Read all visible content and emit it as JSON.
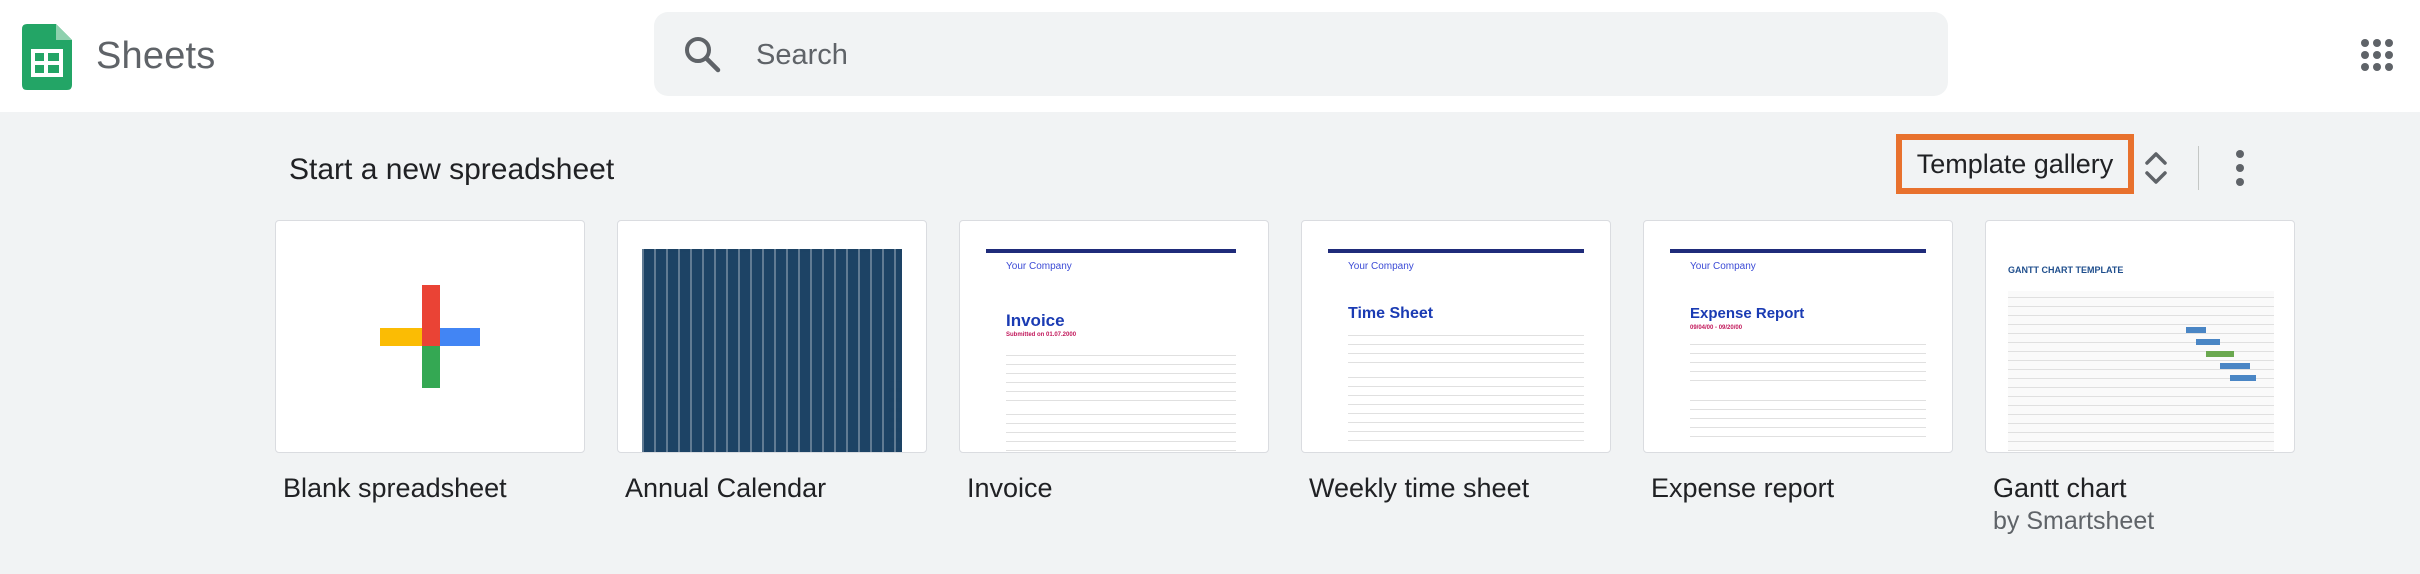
{
  "app": {
    "title": "Sheets"
  },
  "search": {
    "placeholder": "Search"
  },
  "gallery": {
    "section_title": "Start a new spreadsheet",
    "template_gallery_label": "Template gallery",
    "templates": [
      {
        "label": "Blank spreadsheet"
      },
      {
        "label": "Annual Calendar"
      },
      {
        "label": "Invoice"
      },
      {
        "label": "Weekly time sheet"
      },
      {
        "label": "Expense report"
      },
      {
        "label": "Gantt chart",
        "sublabel": "by Smartsheet"
      }
    ]
  },
  "thumbnails": {
    "invoice": {
      "company": "Your Company",
      "heading": "Invoice",
      "accent": "Submitted on 01.07.2000"
    },
    "timesheet": {
      "company": "Your Company",
      "heading": "Time Sheet"
    },
    "expense": {
      "company": "Your Company",
      "heading": "Expense Report",
      "accent": "09/04/00 - 09/20/00"
    },
    "gantt": {
      "heading": "GANTT CHART TEMPLATE"
    }
  },
  "colors": {
    "accent_highlight": "#e8712d",
    "sheets_green": "#23a566",
    "plus_red": "#ea4335",
    "plus_blue": "#4285f4",
    "plus_yellow": "#fbbc04",
    "plus_green": "#34a853"
  },
  "icons": {
    "logo": "sheets-logo-icon",
    "search": "search-icon",
    "apps": "apps-grid-icon",
    "sort": "unfold-more-icon",
    "more": "more-vert-icon"
  }
}
